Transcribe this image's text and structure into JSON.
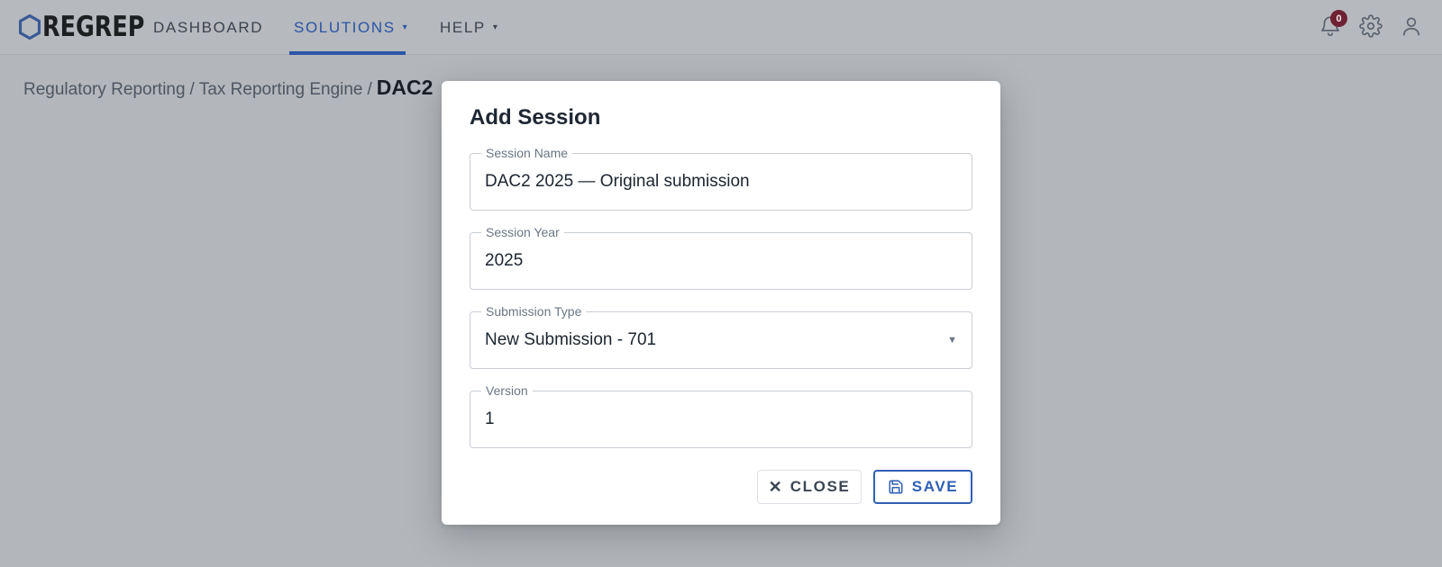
{
  "brand": {
    "logo_text": "REGREP"
  },
  "nav": {
    "dashboard": "DASHBOARD",
    "solutions": "SOLUTIONS",
    "help": "HELP",
    "caret": "▾",
    "active": "solutions"
  },
  "header_icons": [
    "bell-icon",
    "gear-icon",
    "user-icon"
  ],
  "notifications": {
    "count": "0"
  },
  "breadcrumb": {
    "level1": "Regulatory Reporting",
    "level2": "Tax Reporting Engine",
    "current": "DAC2",
    "separator": "/"
  },
  "modal": {
    "title": "Add Session",
    "fields": {
      "session_name": {
        "label": "Session Name",
        "value": "DAC2 2025 — Original submission"
      },
      "session_year": {
        "label": "Session Year",
        "value": "2025"
      },
      "submission_type": {
        "label": "Submission Type",
        "value": "New Submission - 701",
        "caret": "▼"
      },
      "version": {
        "label": "Version",
        "value": "1"
      }
    },
    "buttons": {
      "close": {
        "label": "CLOSE",
        "icon": "✕"
      },
      "save": {
        "label": "SAVE",
        "icon": "save-icon"
      }
    }
  },
  "colors": {
    "accent": "#2f5fb5",
    "overlay_background": "#b3b6ba",
    "badge": "#6e2233"
  }
}
